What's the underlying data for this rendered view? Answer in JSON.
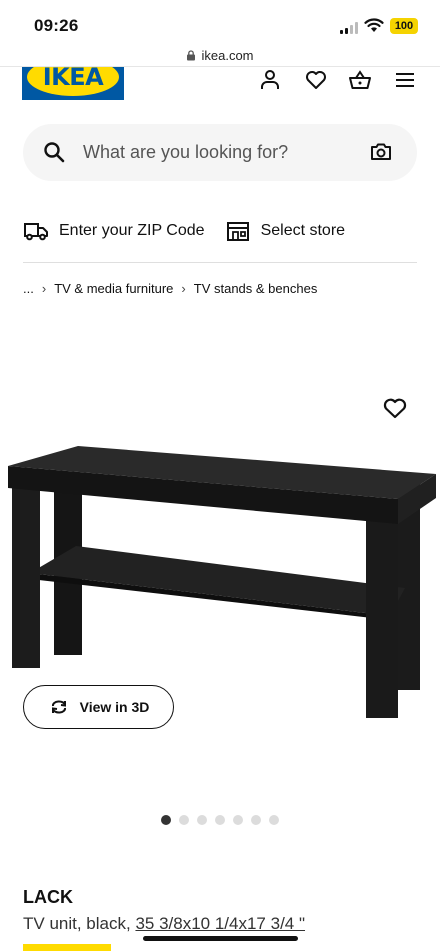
{
  "status_bar": {
    "time": "09:26",
    "battery": "100"
  },
  "browser": {
    "address": "ikea.com"
  },
  "header": {
    "logo_text": "IKEA"
  },
  "search": {
    "placeholder": "What are you looking for?"
  },
  "utility": {
    "zip_label": "Enter your ZIP Code",
    "store_label": "Select store"
  },
  "breadcrumb": {
    "ellipsis": "...",
    "items": [
      "TV & media furniture",
      "TV stands & benches"
    ]
  },
  "product": {
    "view_3d_label": "View in 3D",
    "name": "LACK",
    "description": "TV unit, black,",
    "dimensions": "35 3/8x10 1/4x17 3/4 \"",
    "image_count": 7,
    "active_image": 1
  },
  "colors": {
    "ikea_blue": "#0058a3",
    "ikea_yellow": "#ffdb00"
  }
}
